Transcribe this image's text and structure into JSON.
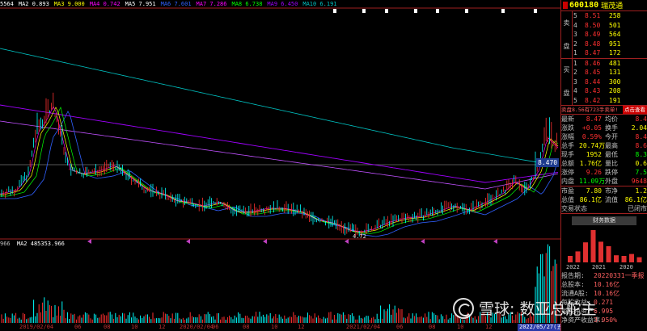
{
  "colors": {
    "up": "#ff3030",
    "down": "#00ffff",
    "ma5": "#ffffff",
    "ma10": "#ffff00",
    "ma20": "#ff00ff",
    "ma60": "#00ff00",
    "ma120": "#3060ff",
    "ma250": "#a000ff",
    "ma500": "#00c0c0",
    "grid": "#a02020"
  },
  "legend": {
    "items": [
      "5564",
      "MA2  0.893",
      "MA3  9.000",
      "MA4  0.742",
      "MA5  7.951",
      "MA6  7.601",
      "MA7  7.286",
      "MA8  6.738",
      "MA9  6.450",
      "MA10  6.191"
    ],
    "volume": "966",
    "volume_ma": "MA2  485353.966"
  },
  "chart": {
    "price_tag": "8.470",
    "low_label": "4.72",
    "date_labels": [
      "2019/02/04",
      "06",
      "08",
      "10",
      "12",
      "2020/02/04",
      "06",
      "08",
      "10",
      "12",
      "2021/02/04",
      "06",
      "08",
      "10",
      "12"
    ],
    "date_badge": "2022/05/27(五)"
  },
  "stock": {
    "code": "600180",
    "name": "瑞茂通"
  },
  "order_book": {
    "ask_label_top": "卖",
    "ask_label_bottom": "盘",
    "bid_label_top": "买",
    "bid_label_bottom": "盘",
    "asks": [
      {
        "level": "5",
        "price": "8.51",
        "volume": "258"
      },
      {
        "level": "4",
        "price": "8.50",
        "volume": "501"
      },
      {
        "level": "3",
        "price": "8.49",
        "volume": "564"
      },
      {
        "level": "2",
        "price": "8.48",
        "volume": "951"
      },
      {
        "level": "1",
        "price": "8.47",
        "volume": "172"
      }
    ],
    "bids": [
      {
        "level": "1",
        "price": "8.46",
        "volume": "481"
      },
      {
        "level": "2",
        "price": "8.45",
        "volume": "131"
      },
      {
        "level": "3",
        "price": "8.44",
        "volume": "300"
      },
      {
        "level": "4",
        "price": "8.43",
        "volume": "208"
      },
      {
        "level": "5",
        "price": "8.42",
        "volume": "191"
      }
    ]
  },
  "trade": {
    "text": "卖盘8.56有723手卖单!",
    "button": "点击查看"
  },
  "quote": [
    {
      "l1": "最新",
      "v1": "8.47",
      "c1": "#ff3030",
      "l2": "均价",
      "v2": "8.4",
      "c2": "#ff3030"
    },
    {
      "l1": "涨跌",
      "v1": "+0.05",
      "c1": "#ff3030",
      "l2": "换手",
      "v2": "2.04",
      "c2": "#ffff00"
    },
    {
      "l1": "涨幅",
      "v1": "0.59%",
      "c1": "#ff3030",
      "l2": "今开",
      "v2": "8.4",
      "c2": "#ff3030"
    },
    {
      "l1": "总手",
      "v1": "20.74万",
      "c1": "#ffff00",
      "l2": "最高",
      "v2": "8.6",
      "c2": "#ff3030"
    },
    {
      "l1": "现手",
      "v1": "1952",
      "c1": "#ffff00",
      "l2": "最低",
      "v2": "8.3",
      "c2": "#00ff00"
    },
    {
      "l1": "总额",
      "v1": "1.76亿",
      "c1": "#ffff00",
      "l2": "量比",
      "v2": "0.6",
      "c2": "#ffff00"
    },
    {
      "l1": "涨停",
      "v1": "9.26",
      "c1": "#ff3030",
      "l2": "跌停",
      "v2": "7.5",
      "c2": "#00ff00"
    },
    {
      "l1": "内盘",
      "v1": "11.09万",
      "c1": "#00ff00",
      "l2": "外盘",
      "v2": "9648",
      "c2": "#ff3030"
    }
  ],
  "quote2": [
    {
      "l1": "市盈",
      "v1": "7.80",
      "c1": "#ffff00",
      "l2": "市净",
      "v2": "1.2",
      "c2": "#ffff00"
    },
    {
      "l1": "总值",
      "v1": "86.1亿",
      "c1": "#ffff00",
      "l2": "流值",
      "v2": "86.1亿",
      "c2": "#ffff00"
    },
    {
      "l1": "交易状态",
      "v1": "",
      "c1": "#ffff00",
      "l2": "",
      "v2": "已闭市",
      "c2": "#c0c0c0"
    }
  ],
  "financial": {
    "button": "财务数据",
    "bars": [
      2.0,
      3.4,
      6.2,
      10.0,
      6.4,
      5.0,
      2.2,
      2.0,
      2.6,
      1.6
    ],
    "years": [
      "2022",
      "2021",
      "2020"
    ]
  },
  "report": [
    {
      "label": "报告期:",
      "value": "20220331一季报"
    },
    {
      "label": "总股本:",
      "value": "10.16亿"
    },
    {
      "label": "流通A股:",
      "value": "10.16亿"
    },
    {
      "label": "每股收益:",
      "value": "0.271"
    },
    {
      "label": "每股净资产:",
      "value": "6.995"
    },
    {
      "label": "净资产收益率:",
      "value": "3.950%"
    }
  ],
  "watermark": "雪球: 数亚总舵主"
}
